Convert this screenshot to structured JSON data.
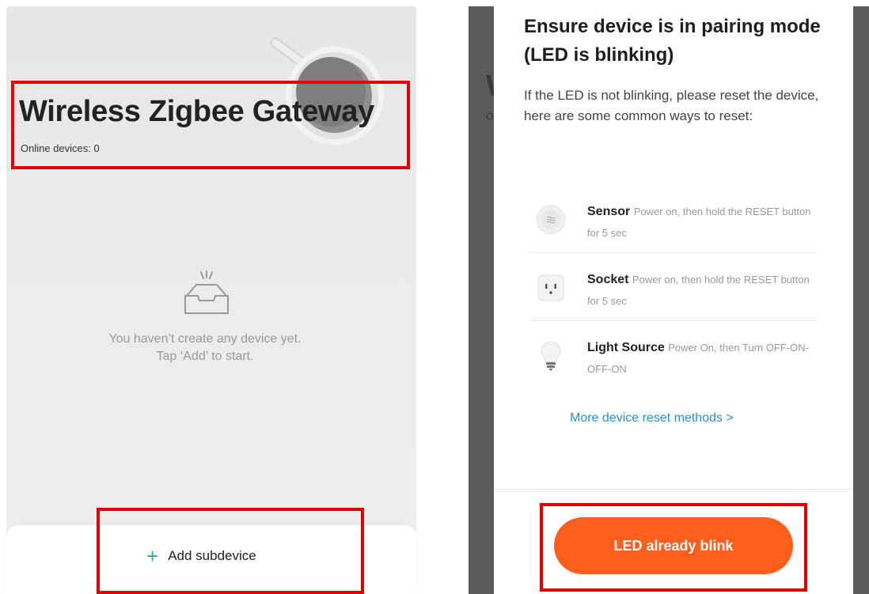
{
  "left": {
    "title": "Wireless Zigbee Gateway",
    "online_devices": "Online devices: 0",
    "empty_line1": "You haven’t create any device yet.",
    "empty_line2": "Tap ‘Add’ to start.",
    "add_icon": "+",
    "add_label": "Add subdevice"
  },
  "right": {
    "title": "Ensure device is in pairing mode (LED is blinking)",
    "description": "If the LED is not blinking, please reset the device, here are some common ways to reset:",
    "devices": [
      {
        "name": "Sensor",
        "desc": "Power on, then hold the RESET button for 5 sec",
        "icon": "sensor-icon"
      },
      {
        "name": "Socket",
        "desc": "Power on, then hold the RESET button for 5 sec",
        "icon": "socket-icon"
      },
      {
        "name": "Light Source",
        "desc": "Power On, then Turn OFF-ON-OFF-ON",
        "icon": "light-bulb-icon"
      }
    ],
    "more_link": "More device reset methods >",
    "confirm_button": "LED already blink"
  },
  "colors": {
    "highlight": "#e00000",
    "accent_orange": "#ff5e1f",
    "link_blue": "#2a8fd8",
    "plus_green": "#1eb39a"
  }
}
